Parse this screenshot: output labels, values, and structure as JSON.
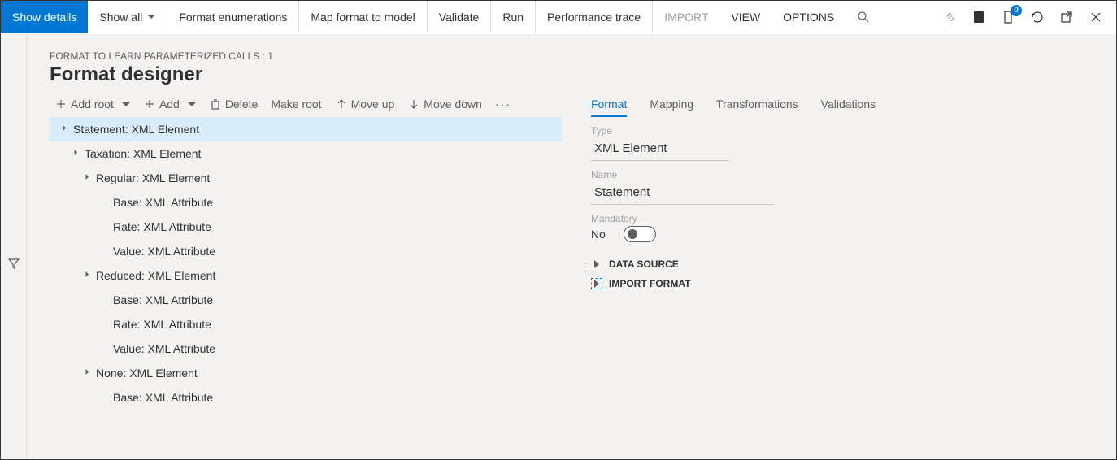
{
  "menubar": {
    "show_details": "Show details",
    "show_all": "Show all",
    "format_enum": "Format enumerations",
    "map_format": "Map format to model",
    "validate": "Validate",
    "run": "Run",
    "perf_trace": "Performance trace",
    "import": "IMPORT",
    "view": "VIEW",
    "options": "OPTIONS",
    "notification_count": "0"
  },
  "breadcrumb": "FORMAT TO LEARN PARAMETERIZED CALLS : 1",
  "page_title": "Format designer",
  "toolbar": {
    "add_root": "Add root",
    "add": "Add",
    "delete": "Delete",
    "make_root": "Make root",
    "move_up": "Move up",
    "move_down": "Move down"
  },
  "tree": {
    "items": [
      {
        "indent": 0,
        "label": "Statement: XML Element",
        "caret": true,
        "selected": true
      },
      {
        "indent": 1,
        "label": "Taxation: XML Element",
        "caret": true
      },
      {
        "indent": 2,
        "label": "Regular: XML Element",
        "caret": true
      },
      {
        "indent": 3,
        "label": "Base: XML Attribute",
        "caret": false
      },
      {
        "indent": 3,
        "label": "Rate: XML Attribute",
        "caret": false
      },
      {
        "indent": 3,
        "label": "Value: XML Attribute",
        "caret": false
      },
      {
        "indent": 2,
        "label": "Reduced: XML Element",
        "caret": true
      },
      {
        "indent": 3,
        "label": "Base: XML Attribute",
        "caret": false
      },
      {
        "indent": 3,
        "label": "Rate: XML Attribute",
        "caret": false
      },
      {
        "indent": 3,
        "label": "Value: XML Attribute",
        "caret": false
      },
      {
        "indent": 2,
        "label": "None: XML Element",
        "caret": true
      },
      {
        "indent": 3,
        "label": "Base: XML Attribute",
        "caret": false
      }
    ]
  },
  "details": {
    "tabs": {
      "format": "Format",
      "mapping": "Mapping",
      "transformations": "Transformations",
      "validations": "Validations"
    },
    "type_label": "Type",
    "type_value": "XML Element",
    "name_label": "Name",
    "name_value": "Statement",
    "mandatory_label": "Mandatory",
    "mandatory_value": "No",
    "data_source": "DATA SOURCE",
    "import_format": "IMPORT FORMAT"
  }
}
